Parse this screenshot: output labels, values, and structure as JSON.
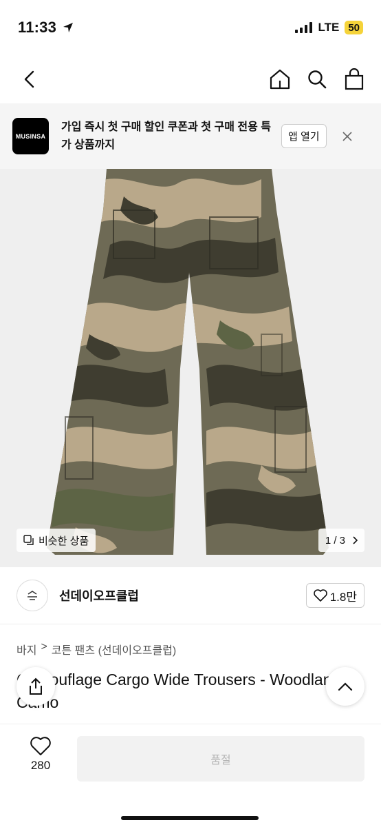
{
  "status_bar": {
    "time": "11:33",
    "network": "LTE",
    "battery": "50"
  },
  "promo": {
    "logo_text": "MUSINSA",
    "message": "가입 즉시 첫 구매 할인 쿠폰과 첫 구매 전용 특가 상품까지",
    "button_label": "앱 열기"
  },
  "product_image": {
    "similar_label": "비슷한 상품",
    "counter": "1 / 3"
  },
  "brand": {
    "avatar_text": "sundayoff",
    "name": "선데이오프클럽",
    "likes": "1.8만"
  },
  "breadcrumb": {
    "items": [
      "바지",
      "코튼 팬츠 (선데이오프클럽)"
    ]
  },
  "product": {
    "title": "Camouflage Cargo Wide Trousers - Woodland Camo"
  },
  "bottom_bar": {
    "wish_count": "280",
    "action_label": "품절"
  },
  "colors": {
    "camo_base": "#6e6a55",
    "camo_tan": "#b9a88a",
    "camo_dark": "#3f3d30",
    "camo_green": "#5d6445"
  }
}
